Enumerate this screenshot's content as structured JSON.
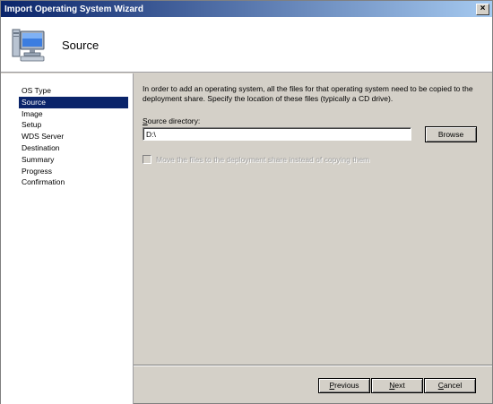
{
  "window": {
    "title": "Import Operating System Wizard",
    "close_glyph": "×"
  },
  "header": {
    "icon": "computer-icon",
    "title": "Source"
  },
  "sidebar": {
    "items": [
      {
        "label": "OS Type",
        "active": false
      },
      {
        "label": "Source",
        "active": true
      },
      {
        "label": "Image",
        "active": false
      },
      {
        "label": "Setup",
        "active": false
      },
      {
        "label": "WDS Server",
        "active": false
      },
      {
        "label": "Destination",
        "active": false
      },
      {
        "label": "Summary",
        "active": false
      },
      {
        "label": "Progress",
        "active": false
      },
      {
        "label": "Confirmation",
        "active": false
      }
    ]
  },
  "main": {
    "intro": "In order to add an operating system, all the files for that operating system need to be copied to the deployment share.  Specify the location of these files (typically a CD drive).",
    "source_label": "Source directory:",
    "source_value": "D:\\",
    "browse_label": "Browse",
    "move_checkbox": {
      "label": "Move the files to the deployment share instead of copying them",
      "checked": false,
      "enabled": false
    }
  },
  "footer": {
    "previous_label": "Previous",
    "next_label": "Next",
    "cancel_label": "Cancel"
  },
  "colors": {
    "titlebar_start": "#0a246a",
    "titlebar_end": "#a6caf0",
    "selection": "#0a246a",
    "dialog_bg": "#d4d0c8"
  }
}
